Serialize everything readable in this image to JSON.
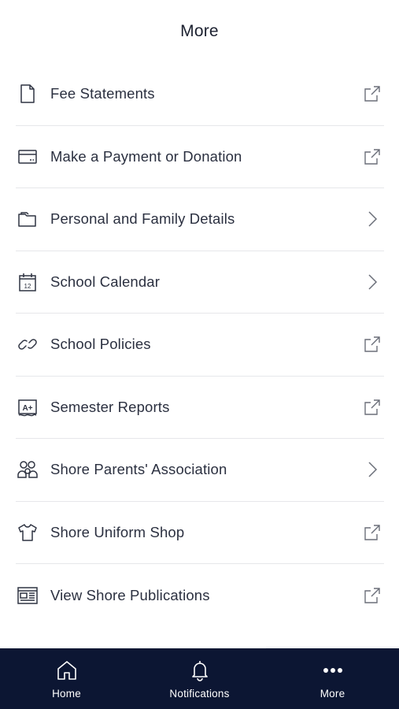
{
  "header": {
    "title": "More"
  },
  "menu": {
    "items": [
      {
        "label": "Fee Statements",
        "icon": "document-icon",
        "trail": "external-link-icon"
      },
      {
        "label": "Make a Payment or Donation",
        "icon": "credit-card-icon",
        "trail": "external-link-icon"
      },
      {
        "label": "Personal and Family Details",
        "icon": "folder-icon",
        "trail": "chevron-right-icon"
      },
      {
        "label": "School Calendar",
        "icon": "calendar-icon",
        "trail": "chevron-right-icon"
      },
      {
        "label": "School Policies",
        "icon": "link-icon",
        "trail": "external-link-icon"
      },
      {
        "label": "Semester Reports",
        "icon": "grade-report-icon",
        "trail": "external-link-icon"
      },
      {
        "label": "Shore Parents' Association",
        "icon": "people-icon",
        "trail": "chevron-right-icon"
      },
      {
        "label": "Shore Uniform Shop",
        "icon": "tshirt-icon",
        "trail": "external-link-icon"
      },
      {
        "label": "View Shore Publications",
        "icon": "newspaper-icon",
        "trail": "external-link-icon"
      }
    ],
    "calendar_day": "12",
    "grade_text": "A+"
  },
  "tabbar": {
    "tabs": [
      {
        "label": "Home",
        "icon": "home-icon"
      },
      {
        "label": "Notifications",
        "icon": "bell-icon"
      },
      {
        "label": "More",
        "icon": "more-dots-icon",
        "active": true
      }
    ]
  },
  "colors": {
    "tabbar_bg": "#0c1633",
    "text": "#2b3040",
    "divider": "#e6e7ea",
    "icon": "#3a3f4d"
  }
}
